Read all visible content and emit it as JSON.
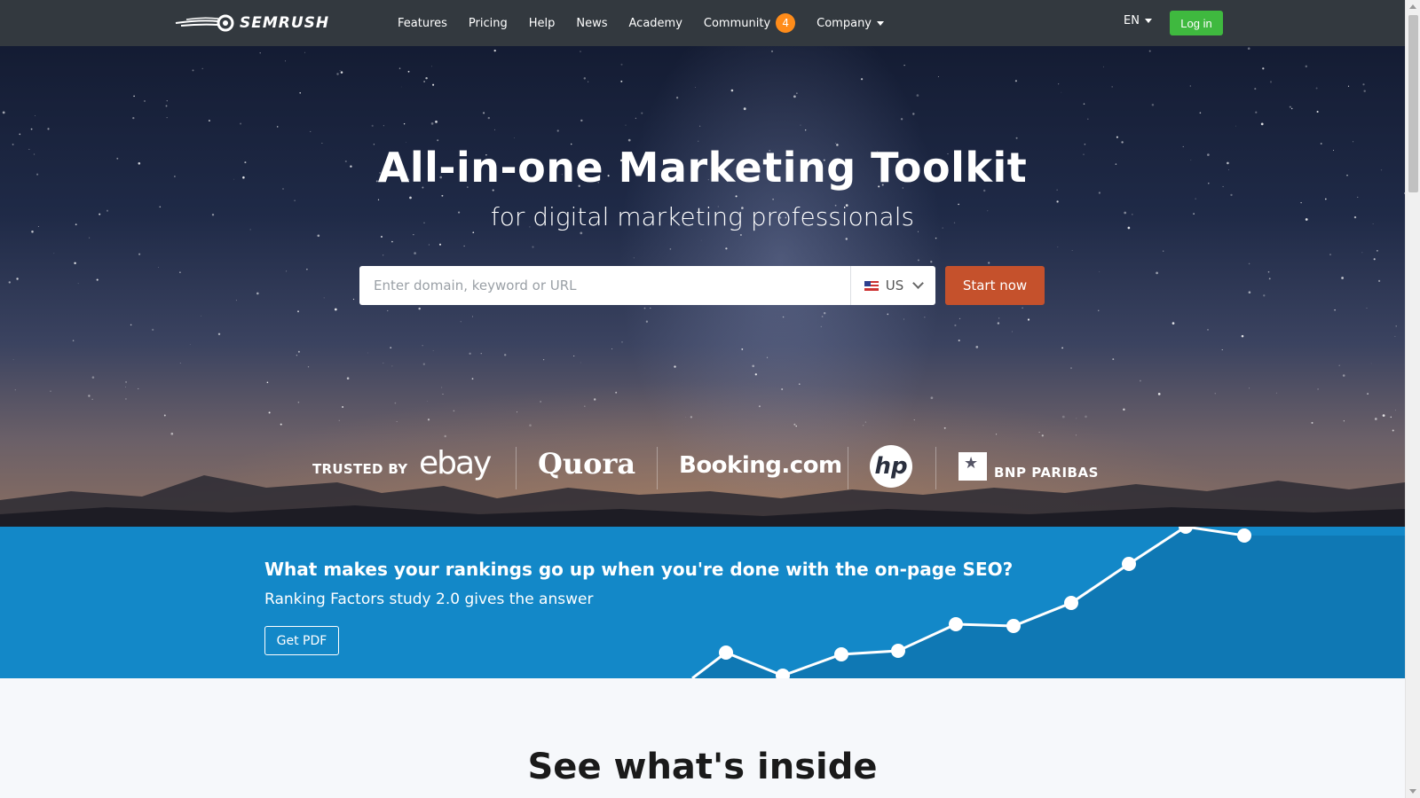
{
  "nav": {
    "logo_text": "SEMRUSH",
    "items": [
      {
        "label": "Features"
      },
      {
        "label": "Pricing"
      },
      {
        "label": "Help"
      },
      {
        "label": "News"
      },
      {
        "label": "Academy"
      },
      {
        "label": "Community",
        "badge": "4"
      },
      {
        "label": "Company",
        "dropdown": true
      }
    ],
    "language": "EN",
    "login_label": "Log in"
  },
  "hero": {
    "title": "All-in-one Marketing Toolkit",
    "subtitle": "for digital marketing professionals",
    "search": {
      "placeholder": "Enter domain, keyword or URL",
      "value": "",
      "country": "US"
    },
    "start_label": "Start now",
    "trusted_label": "TRUSTED BY",
    "brands": [
      "ebay",
      "Quora",
      "Booking.com",
      "hp",
      "BNP PARIBAS"
    ]
  },
  "promo": {
    "title": "What makes your rankings go up when you're done with the on-page SEO?",
    "subtitle": "Ranking Factors study 2.0 gives the answer",
    "button_label": "Get PDF"
  },
  "inside": {
    "title": "See what's inside"
  },
  "colors": {
    "nav_bg": "#33393f",
    "login_green": "#3fb93f",
    "start_orange": "#c5512c",
    "badge_orange": "#ff8c1a",
    "promo_blue": "#1388c8"
  }
}
